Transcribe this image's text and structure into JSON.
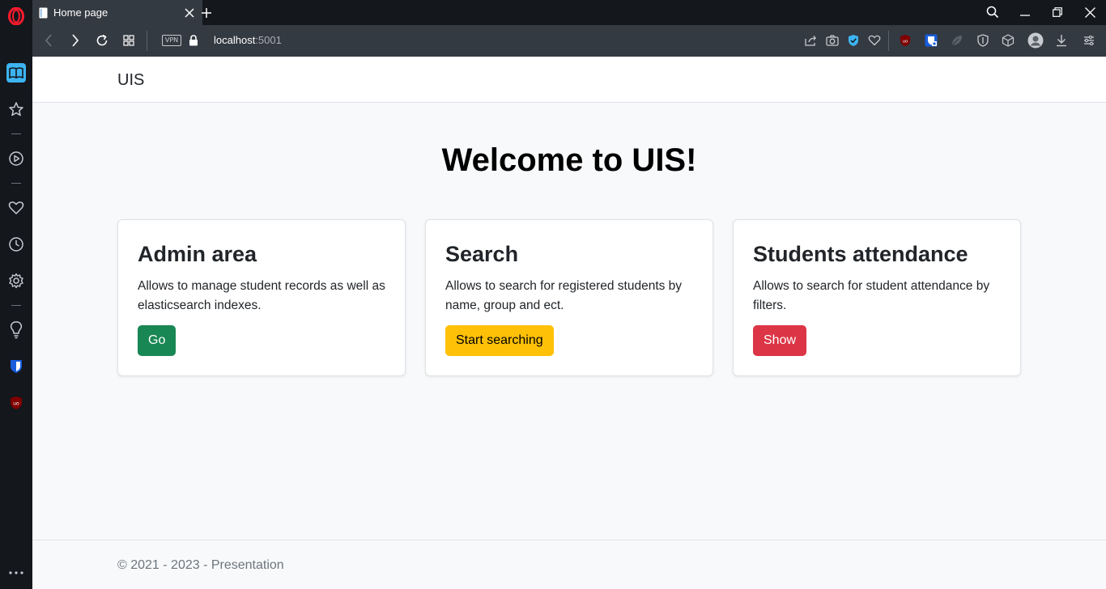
{
  "browser": {
    "tab": {
      "title": "Home page"
    },
    "address": {
      "host": "localhost",
      "port": ":5001"
    },
    "vpn_label": "VPN"
  },
  "page": {
    "brand": "UIS",
    "heading": "Welcome to UIS!",
    "cards": [
      {
        "title": "Admin area",
        "text": "Allows to manage student records as well as elasticsearch indexes.",
        "button": "Go",
        "button_color": "#198754",
        "button_text_color": "#ffffff"
      },
      {
        "title": "Search",
        "text": "Allows to search for registered students by name, group and ect.",
        "button": "Start searching",
        "button_color": "#ffc107",
        "button_text_color": "#000000"
      },
      {
        "title": "Students attendance",
        "text": "Allows to search for student attendance by filters.",
        "button": "Show",
        "button_color": "#dc3545",
        "button_text_color": "#ffffff"
      }
    ],
    "footer": "© 2021 - 2023 - Presentation"
  },
  "icons": {
    "sidebar": [
      "opera-logo-icon",
      "reading-list-icon",
      "speed-dial-icon",
      "player-icon",
      "bookmarks-heart-icon",
      "history-clock-icon",
      "settings-gear-icon",
      "lightbulb-icon",
      "bitwarden-icon",
      "ublock-icon",
      "more-icon"
    ],
    "toolbar": [
      "back-icon",
      "forward-icon",
      "reload-icon",
      "tab-grid-icon",
      "lock-icon",
      "share-icon",
      "camera-icon",
      "shield-check-icon",
      "heart-icon",
      "ublock-extension-icon",
      "bitwarden-extension-icon",
      "leaf-extension-icon",
      "shield-extension-icon",
      "cube-extension-icon",
      "profile-avatar-icon",
      "download-icon",
      "easy-setup-icon"
    ]
  }
}
